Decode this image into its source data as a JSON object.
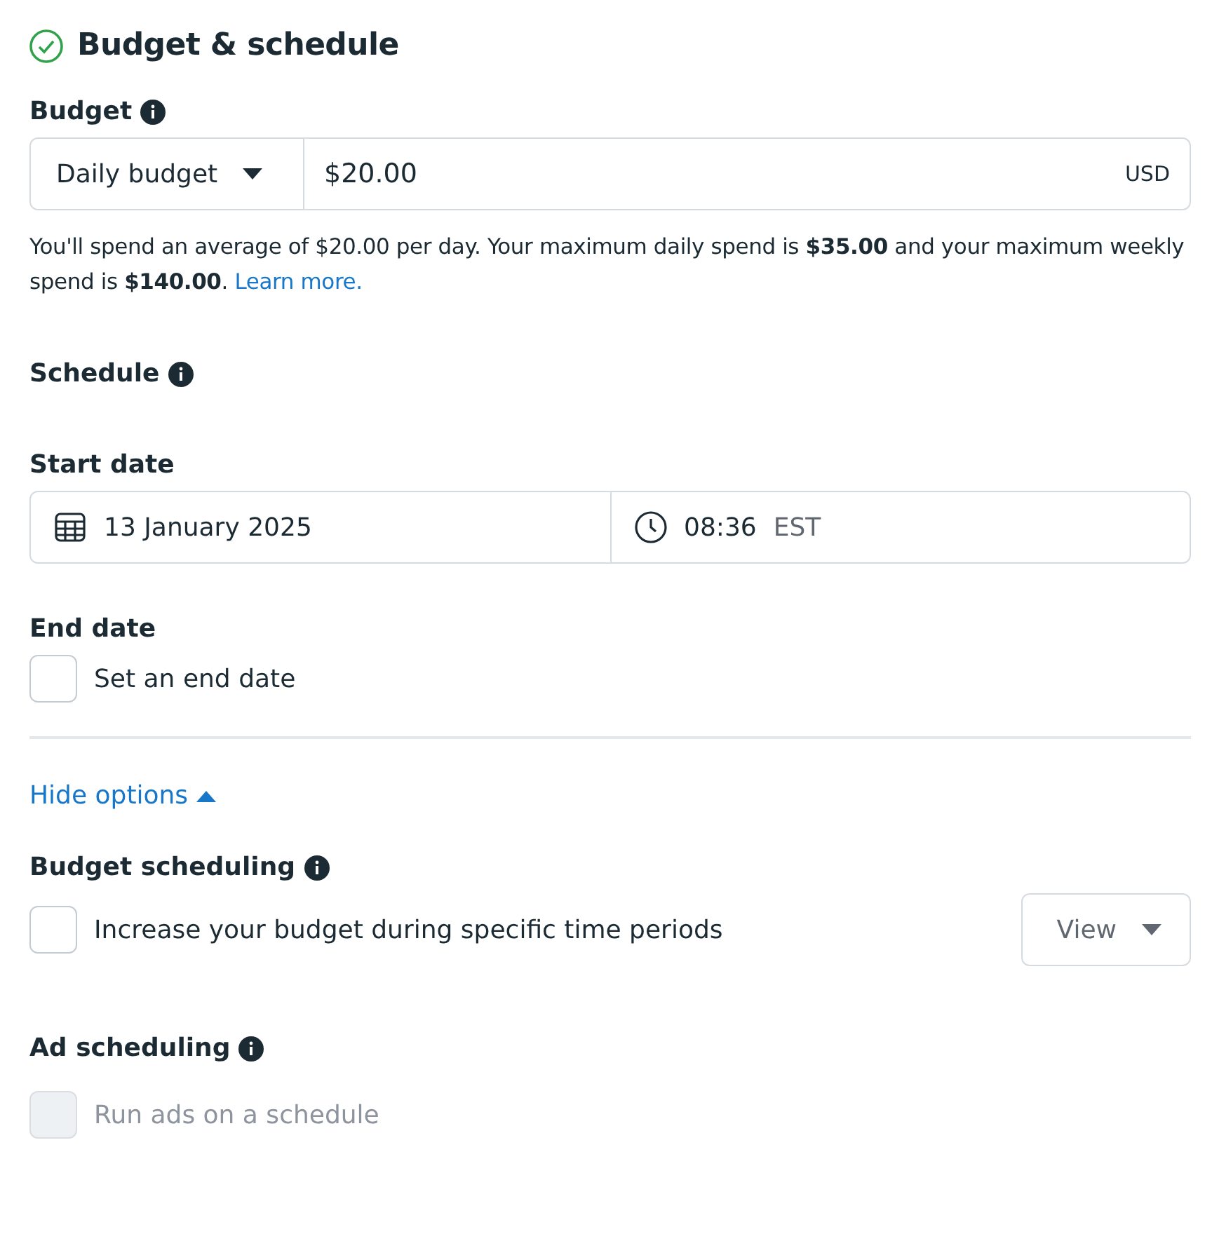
{
  "section": {
    "title": "Budget & schedule",
    "complete": true
  },
  "budget": {
    "label": "Budget",
    "type_select": "Daily budget",
    "amount": "$20.00",
    "currency": "USD",
    "help": "You'll spend an average of $20.00 per day. Your maximum daily spend is **$35.00** and your maximum weekly spend is **$140.00**.",
    "help_link": "Learn more."
  },
  "schedule": {
    "label": "Schedule"
  },
  "start_date": {
    "label": "Start date",
    "date": "13 January 2025",
    "time": "08:36",
    "timezone": "EST"
  },
  "end_date": {
    "label": "End date",
    "checkbox": {
      "label": "Set an end date",
      "checked": false,
      "disabled": false
    }
  },
  "options_toggle": {
    "label": "Hide options",
    "expanded": true
  },
  "budget_scheduling": {
    "label": "Budget scheduling",
    "checkbox": {
      "label": "Increase your budget during specific time periods",
      "checked": false,
      "disabled": false
    },
    "view_button": "View"
  },
  "ad_scheduling": {
    "label": "Ad scheduling",
    "checkbox": {
      "label": "Run ads on a schedule",
      "checked": false,
      "disabled": true
    }
  }
}
